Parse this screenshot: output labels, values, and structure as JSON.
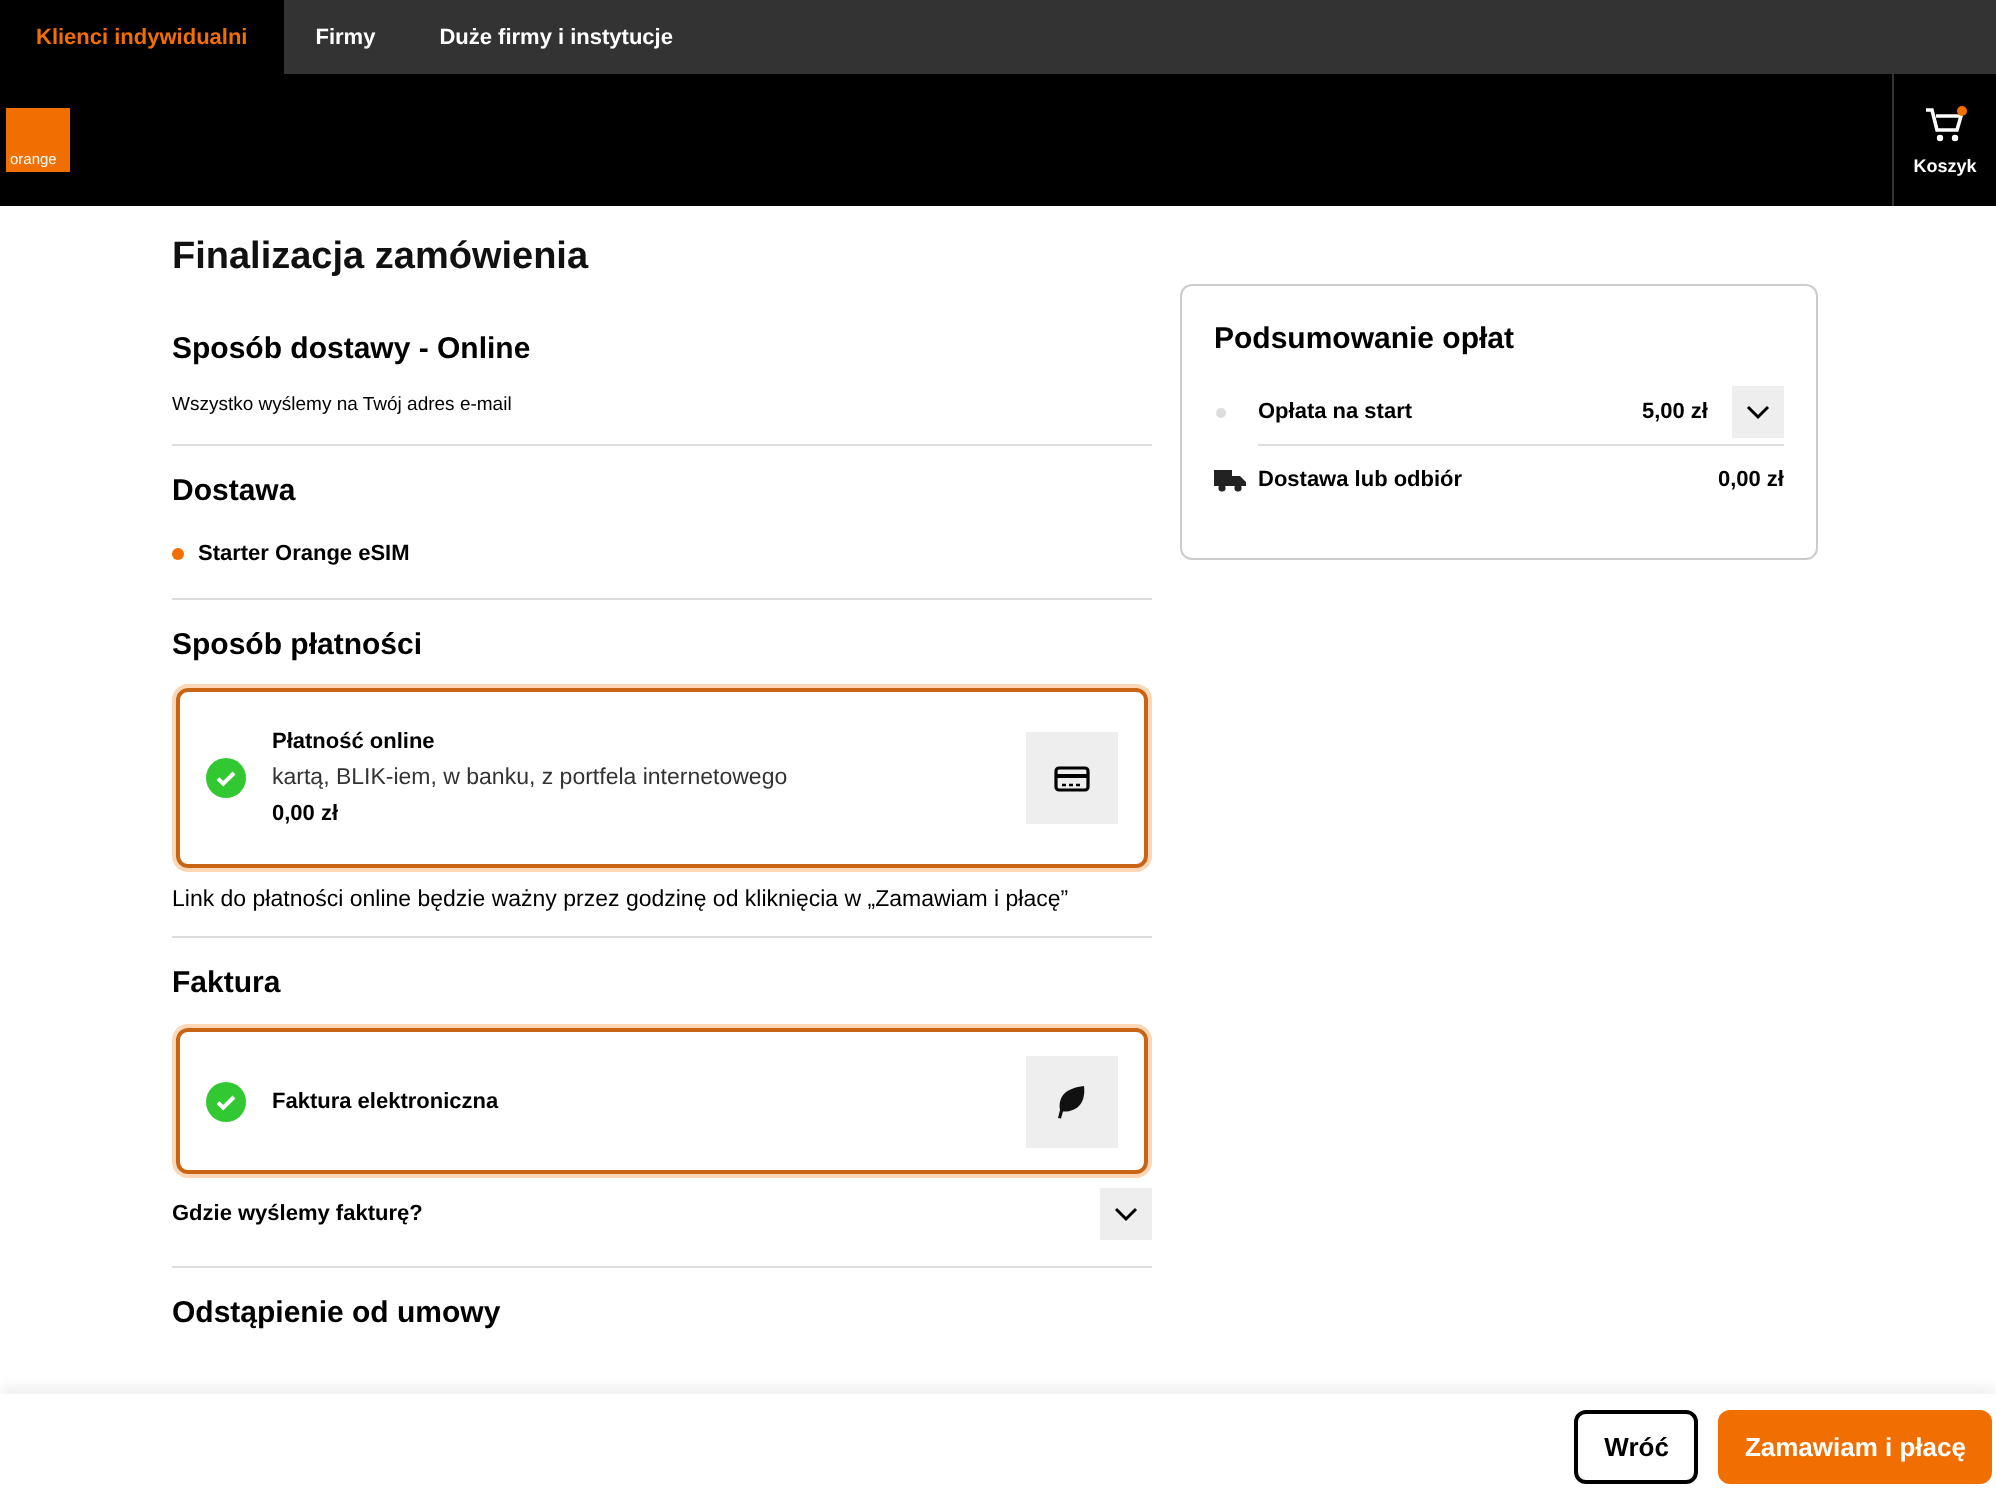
{
  "top_nav": {
    "tabs": [
      {
        "label": "Klienci indywidualni",
        "selected": true
      },
      {
        "label": "Firmy",
        "selected": false
      },
      {
        "label": "Duże firmy i instytucje",
        "selected": false
      }
    ]
  },
  "header": {
    "logo": "orange",
    "cart": {
      "label": "Koszyk"
    }
  },
  "page_title": "Finalizacja zamówienia",
  "delivery_method": {
    "title": "Sposób dostawy - Online",
    "text": "Wszystko wyślemy na Twój adres e-mail"
  },
  "delivery": {
    "title": "Dostawa",
    "items": [
      "Starter Orange eSIM"
    ]
  },
  "payment": {
    "title": "Sposób płatności",
    "option": {
      "title": "Płatność online",
      "description": "kartą, BLIK-iem, w banku, z portfela internetowego",
      "price": "0,00 zł",
      "selected": true
    },
    "note": "Link do płatności online będzie ważny przez godzinę od kliknięcia w „Zamawiam i płacę”"
  },
  "invoice": {
    "title": "Faktura",
    "option": {
      "title": "Faktura elektroniczna",
      "selected": true
    },
    "expander": {
      "label": "Gdzie wyślemy fakturę?",
      "expanded": false
    }
  },
  "withdrawal": {
    "title": "Odstąpienie od umowy"
  },
  "summary": {
    "title": "Podsumowanie opłat",
    "rows": [
      {
        "kind": "expandable",
        "label": "Opłata na start",
        "amount": "5,00 zł"
      },
      {
        "kind": "delivery",
        "label": "Dostawa lub odbiór",
        "amount": "0,00 zł"
      }
    ]
  },
  "footer": {
    "buttons": [
      {
        "label": "Wróć",
        "kind": "secondary"
      },
      {
        "label": "Zamawiam i płacę",
        "kind": "primary"
      }
    ]
  }
}
